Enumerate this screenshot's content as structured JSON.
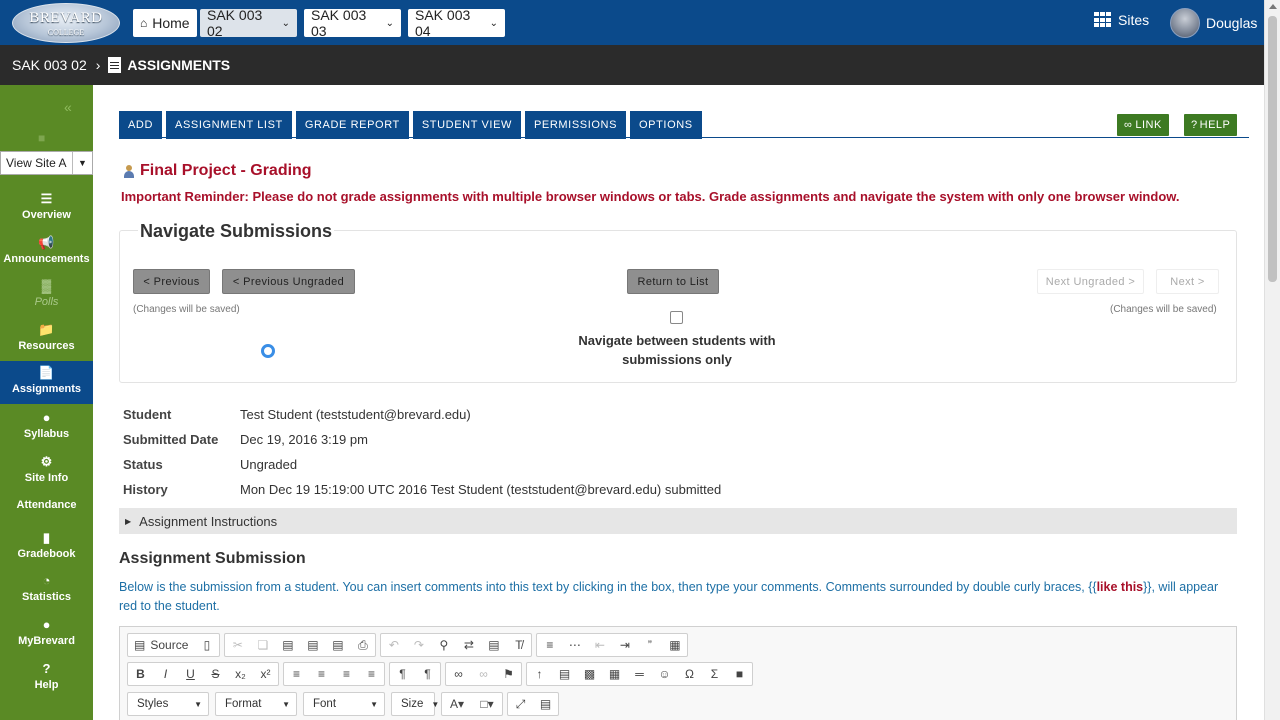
{
  "header": {
    "logo_text": "BREVARD",
    "logo_sub": "COLLEGE",
    "home_label": "Home",
    "site_tabs": [
      "SAK 003 02",
      "SAK 003 03",
      "SAK 003 04"
    ],
    "sites_label": "Sites",
    "user_name": "Douglas"
  },
  "breadcrumb": {
    "site": "SAK 003 02",
    "page": "ASSIGNMENTS"
  },
  "sidebar": {
    "view_site_label": "View Site A",
    "items": [
      {
        "label": "Overview",
        "icon": "list-icon"
      },
      {
        "label": "Announcements",
        "icon": "megaphone-icon"
      },
      {
        "label": "Polls",
        "icon": "bar-chart-icon"
      },
      {
        "label": "Resources",
        "icon": "folder-icon"
      },
      {
        "label": "Assignments",
        "icon": "document-icon"
      },
      {
        "label": "Syllabus",
        "icon": "globe-icon"
      },
      {
        "label": "Site Info",
        "icon": "gear-icon"
      },
      {
        "label": "Attendance",
        "icon": ""
      },
      {
        "label": "Gradebook",
        "icon": "book-icon"
      },
      {
        "label": "Statistics",
        "icon": "pie-chart-icon"
      },
      {
        "label": "MyBrevard",
        "icon": "globe-icon"
      },
      {
        "label": "Help",
        "icon": "question-icon"
      }
    ]
  },
  "toolbar": {
    "tabs": [
      "ADD",
      "ASSIGNMENT LIST",
      "GRADE REPORT",
      "STUDENT VIEW",
      "PERMISSIONS",
      "OPTIONS"
    ],
    "link_label": "LINK",
    "help_label": "HELP"
  },
  "page": {
    "title": "Final Project - Grading",
    "reminder": "Important Reminder: Please do not grade assignments with multiple browser windows or tabs. Grade assignments and navigate the system with only one browser window."
  },
  "navigate": {
    "title": "Navigate Submissions",
    "previous": "< Previous",
    "previous_ungraded": "< Previous Ungraded",
    "return_to_list": "Return to List",
    "next_ungraded": "Next Ungraded >",
    "next": "Next >",
    "changes_saved": "(Changes will be saved)",
    "checkbox_label": "Navigate between students with submissions only",
    "checkbox_checked": false
  },
  "submission_info": {
    "student_label": "Student",
    "student_value": "Test Student (teststudent@brevard.edu)",
    "submitted_label": "Submitted Date",
    "submitted_value": "Dec 19, 2016 3:19 pm",
    "status_label": "Status",
    "status_value": "Ungraded",
    "history_label": "History",
    "history_value": "Mon Dec 19 15:19:00 UTC 2016 Test Student (teststudent@brevard.edu) submitted"
  },
  "instructions_label": "Assignment Instructions",
  "submission": {
    "title": "Assignment Submission",
    "desc_before": "Below is the submission from a student. You can insert comments into this text by clicking in the box, then type your comments. Comments surrounded by double curly braces, {{",
    "desc_red": "like this",
    "desc_after": "}}, will appear red to the student."
  },
  "editor": {
    "source_label": "Source",
    "styles": "Styles",
    "format": "Format",
    "font": "Font",
    "size": "Size"
  },
  "colors": {
    "blue": "#0b4a8b",
    "green": "#5a8a25",
    "red": "#a8102a"
  }
}
